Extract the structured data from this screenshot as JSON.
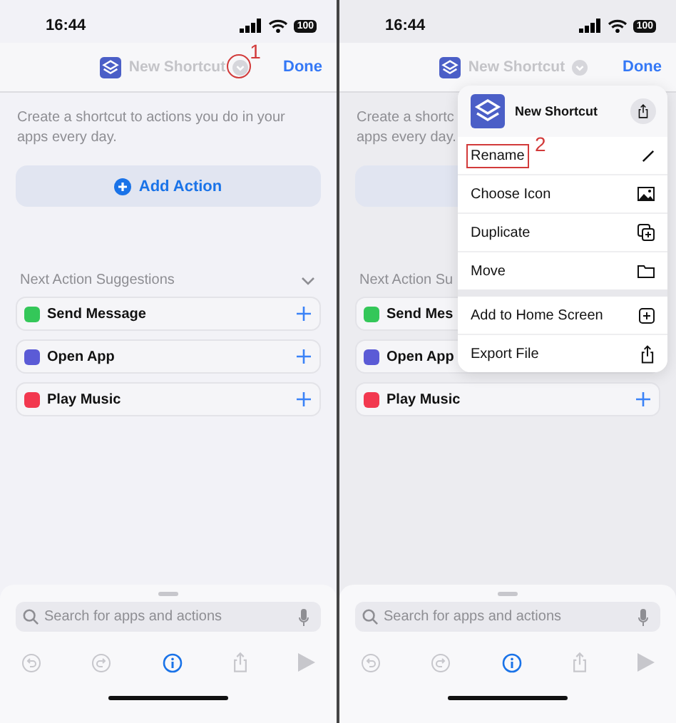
{
  "screens": [
    {
      "status_bar": {
        "time": "16:44",
        "battery": "100"
      },
      "nav": {
        "title": "New Shortcut",
        "done": "Done",
        "annotation": "1"
      },
      "intro_lines": [
        "Create a shortcut to actions you do in your",
        "apps every day."
      ],
      "add_action": {
        "label": "Add Action"
      },
      "suggestions": {
        "title": "Next Action Suggestions",
        "items": [
          {
            "label": "Send Message",
            "color": "#34c759",
            "plus": true
          },
          {
            "label": "Open App",
            "color": "#5b5bd6",
            "plus": true
          },
          {
            "label": "Play Music",
            "color": "#f2384f",
            "plus": true
          }
        ]
      },
      "search": {
        "placeholder": "Search for apps and actions"
      }
    },
    {
      "status_bar": {
        "time": "16:44",
        "battery": "100"
      },
      "nav": {
        "title": "New Shortcut",
        "done": "Done"
      },
      "intro_lines": [
        "Create a shortc",
        "apps every day."
      ],
      "suggestions": {
        "title": "Next Action Su",
        "items": [
          {
            "label": "Send Mes",
            "color": "#34c759"
          },
          {
            "label": "Open App",
            "color": "#5b5bd6"
          },
          {
            "label": "Play Music",
            "color": "#f2384f",
            "plus": true
          }
        ]
      },
      "search": {
        "placeholder": "Search for apps and actions"
      },
      "menu": {
        "title": "New Shortcut",
        "annotation": "2",
        "groups": [
          [
            {
              "label": "Rename",
              "kind": "pencil",
              "annotated": true
            },
            {
              "label": "Choose Icon",
              "kind": "image",
              "annotated": false
            },
            {
              "label": "Duplicate",
              "kind": "duplicate",
              "annotated": false
            },
            {
              "label": "Move",
              "kind": "folder",
              "annotated": false
            }
          ],
          [
            {
              "label": "Add to Home Screen",
              "kind": "add",
              "annotated": false
            },
            {
              "label": "Export File",
              "kind": "export",
              "annotated": false
            }
          ]
        ]
      }
    }
  ]
}
